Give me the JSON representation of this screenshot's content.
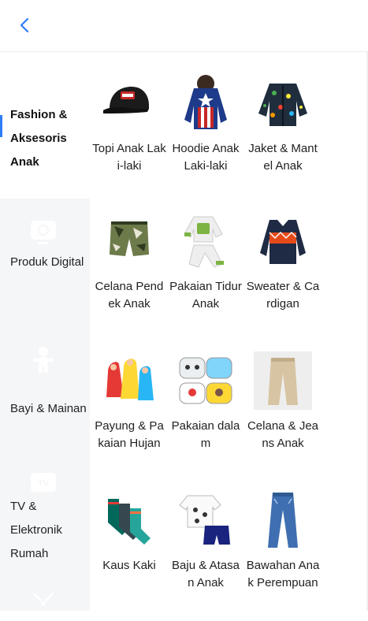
{
  "header": {
    "back_icon": "chevron-left-icon",
    "accent": "#2e7cf6"
  },
  "sidebar": {
    "items": [
      {
        "label": "Fashion & Aksesoris Anak",
        "active": true,
        "icon": ""
      },
      {
        "label": "Produk Digital",
        "active": false,
        "icon": "monitor-icon"
      },
      {
        "label": "Bayi & Mainan",
        "active": false,
        "icon": "baby-icon"
      },
      {
        "label": "TV & Elektronik Rumah",
        "active": false,
        "icon": "tv-icon"
      },
      {
        "label": "",
        "active": false,
        "icon": "sparkle-icon"
      }
    ]
  },
  "products": [
    {
      "name": "Topi Anak Laki-laki",
      "icon": "cap-image"
    },
    {
      "name": "Hoodie Anak Laki-laki",
      "icon": "hoodie-image"
    },
    {
      "name": "Jaket & Mantel Anak",
      "icon": "jacket-image"
    },
    {
      "name": "Celana Pendek Anak",
      "icon": "shorts-image"
    },
    {
      "name": "Pakaian Tidur Anak",
      "icon": "pajamas-image"
    },
    {
      "name": "Sweater & Cardigan",
      "icon": "sweater-image"
    },
    {
      "name": "Payung & Pakaian Hujan",
      "icon": "raincoat-image"
    },
    {
      "name": "Pakaian dalam",
      "icon": "underwear-image"
    },
    {
      "name": "Celana & Jeans Anak",
      "icon": "pants-image"
    },
    {
      "name": "Kaus Kaki",
      "icon": "socks-image"
    },
    {
      "name": "Baju & Atasan Anak",
      "icon": "tshirt-set-image"
    },
    {
      "name": "Bawahan Anak Perempuan",
      "icon": "jeans-image"
    }
  ]
}
